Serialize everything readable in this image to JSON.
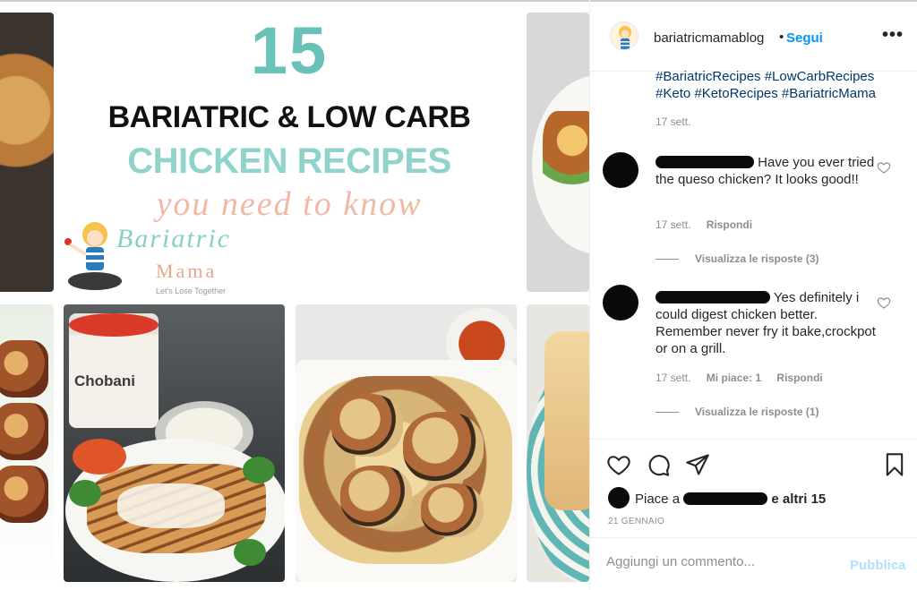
{
  "banner": {
    "number": "15",
    "line1": "BARIATRIC & LOW CARB",
    "line2": "CHICKEN RECIPES",
    "line3": "you need to know",
    "logo_word1": "Bariatric",
    "logo_word2": "Mama",
    "logo_tagline": "Let's Lose Together"
  },
  "tile_text": {
    "chobani": "Chobani"
  },
  "header": {
    "username": "bariatricmamablog",
    "separator": "•",
    "follow_label": "Segui",
    "more_label": "•••"
  },
  "caption": {
    "hashtags_line1": "#BariatricRecipes #LowCarbRecipes",
    "hashtags_line2": "#Keto #KetoRecipes #BariatricMama",
    "date": "17 sett."
  },
  "comments": [
    {
      "text": "Have you ever tried the queso chicken? It looks good!!",
      "date": "17 sett.",
      "reply_label": "Rispondi",
      "view_replies": "Visualizza le risposte (3)"
    },
    {
      "text": "Yes definitely i could digest chicken better. Remember never fry it bake,crockpot or on a grill.",
      "date": "17 sett.",
      "likes_label": "Mi piace: 1",
      "reply_label": "Rispondi",
      "view_replies": "Visualizza le risposte (1)"
    }
  ],
  "likes": {
    "prefix": "Piace a",
    "suffix": "e altri 15"
  },
  "post_time": "21 GENNAIO",
  "composer": {
    "placeholder": "Aggiungi un commento...",
    "publish_label": "Pubblica"
  },
  "icons": {
    "like": "heart-icon",
    "comment": "comment-bubble-icon",
    "share": "paper-plane-icon",
    "save": "bookmark-icon",
    "comment_like": "small-heart-icon",
    "more": "ellipsis-icon"
  },
  "colors": {
    "link_blue": "#0095f6",
    "hashtag_blue": "#00376b",
    "muted": "#8e8e8e",
    "publish_disabled": "#b2dffc",
    "banner_teal": "#69c2b8",
    "banner_peach": "#f0b9a3"
  }
}
